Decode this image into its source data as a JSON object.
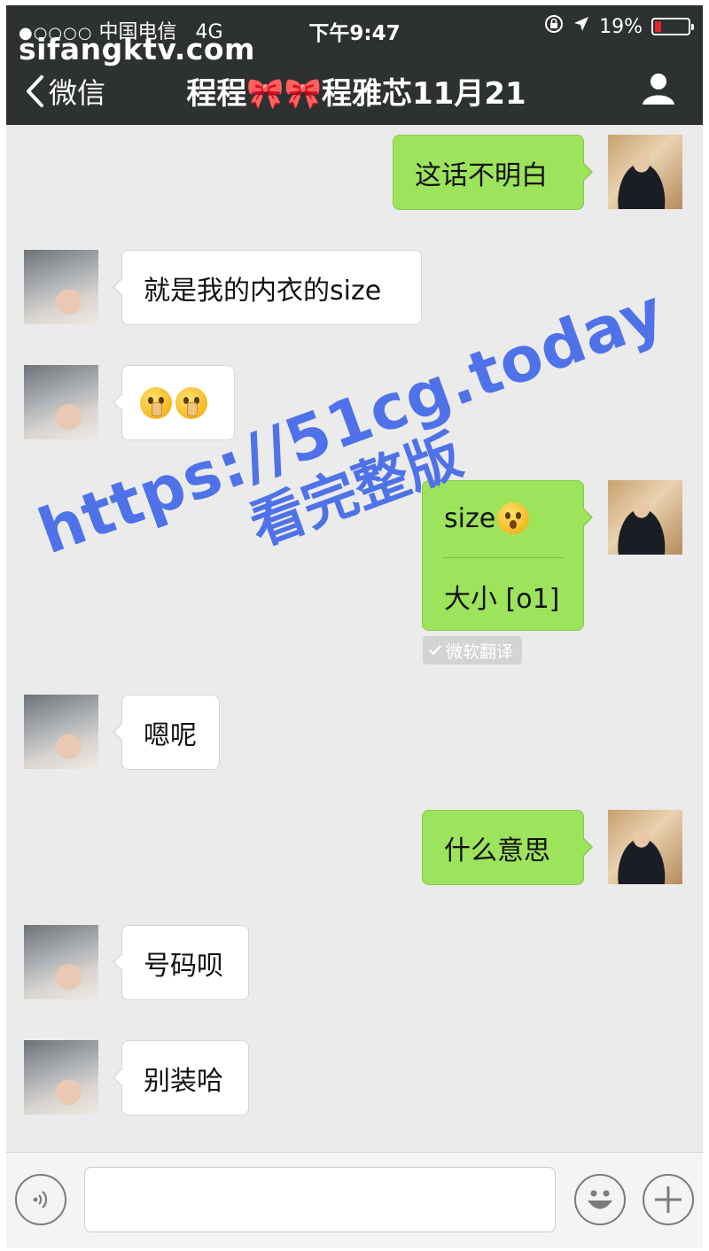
{
  "status_bar": {
    "signal_dots": "●○○○○",
    "carrier": "中国电信",
    "network": "4G",
    "time": "下午9:47",
    "battery_percent": "19%",
    "battery_level": 0.19
  },
  "watermark_site": "sifangktv.com",
  "nav": {
    "back_label": "微信",
    "title_prefix": "程程",
    "title_bows": "🎀🎀",
    "title_suffix": "程雅芯11月21"
  },
  "messages": [
    {
      "side": "right",
      "text": "这话不明白"
    },
    {
      "side": "left",
      "text": "就是我的内衣的size"
    },
    {
      "side": "left",
      "emoji": [
        "shushing-face",
        "shushing-face"
      ]
    },
    {
      "side": "right",
      "text": "size",
      "emoji": "flushed-face",
      "translation": "大小 [o1]"
    },
    {
      "side": "left",
      "text": "嗯呢"
    },
    {
      "side": "right",
      "text": "什么意思"
    },
    {
      "side": "left",
      "text": "号码呗"
    },
    {
      "side": "left",
      "text": "别装哈"
    }
  ],
  "translation_tag": "微软翻译",
  "overlay_watermark": {
    "url": "https://51cg.today",
    "cn": "看完整版",
    "color": "#4f72e8"
  },
  "colors": {
    "header_bg": "#2e3132",
    "chat_bg": "#ebebeb",
    "my_bubble": "#9de35c",
    "their_bubble": "#ffffff"
  },
  "input_bar": {
    "voice_icon": "voice-icon",
    "emoji_icon": "emoji-icon",
    "plus_icon": "plus-icon"
  }
}
